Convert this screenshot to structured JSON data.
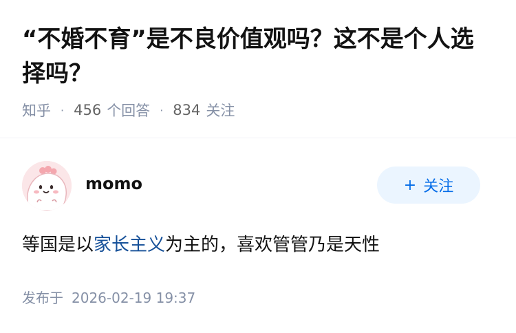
{
  "question": {
    "title": "“不婚不育”是不良价值观吗？这不是个人选择吗？",
    "source": "知乎",
    "answer_count": "456",
    "answer_label": "个回答",
    "follower_count": "834",
    "follower_label": "关注"
  },
  "answer": {
    "author_name": "momo",
    "follow_label": "关注",
    "content_before": "等国是以",
    "content_link": "家长主义",
    "content_after": "为主的，喜欢管管乃是天性",
    "publish_label": "发布于",
    "publish_time": "2026-02-19 19:37"
  },
  "icons": {
    "follow": "plus-icon",
    "avatar": "cartoon-avatar-image"
  },
  "colors": {
    "brand_blue": "#056de8",
    "link_blue": "#175199",
    "follow_bg": "#ebf5ff",
    "meta_gray": "#8590a6"
  }
}
